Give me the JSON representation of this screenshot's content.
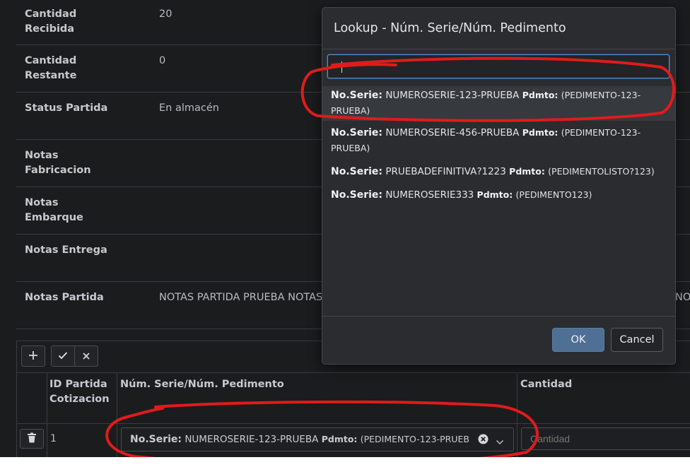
{
  "form": {
    "rows": [
      {
        "label": "Cantidad Recibida",
        "value": "20"
      },
      {
        "label": "Cantidad Restante",
        "value": "0"
      },
      {
        "label": "Status Partida",
        "value": "En almacén"
      },
      {
        "label": "Notas Fabricacion",
        "value": ""
      },
      {
        "label": "Notas Embarque",
        "value": ""
      },
      {
        "label": "Notas Entrega",
        "value": ""
      },
      {
        "label": "Notas Partida",
        "value": "NOTAS PARTIDA PRUEBA NOTAS",
        "value_overflow": "NOT"
      }
    ]
  },
  "grid": {
    "toolbar": {
      "add_icon": "plus-icon",
      "save_icon": "check-icon",
      "cancel_icon": "x-icon"
    },
    "headers": {
      "id": "ID Partida Cotizacion",
      "serie": "Núm. Serie/Núm. Pedimento",
      "cantidad": "Cantidad"
    },
    "row": {
      "id": "1",
      "delete_icon": "trash-icon",
      "serie_key": "No.Serie:",
      "serie_value": "NUMEROSERIE-123-PRUEBA",
      "pdmto_key": "Pdmto:",
      "pdmto_value": "(PEDIMENTO-123-PRUEB",
      "cantidad_placeholder": "Cantidad"
    }
  },
  "modal": {
    "title": "Lookup - Núm. Serie/Núm. Pedimento",
    "search_value": "",
    "options": [
      {
        "serie_key": "No.Serie:",
        "serie": "NUMEROSERIE-123-PRUEBA",
        "pdmto_key": "Pdmto:",
        "pdmto": "(PEDIMENTO-123-PRUEBA)",
        "selected": true
      },
      {
        "serie_key": "No.Serie:",
        "serie": "NUMEROSERIE-456-PRUEBA",
        "pdmto_key": "Pdmto:",
        "pdmto": "(PEDIMENTO-123-PRUEBA)",
        "selected": false
      },
      {
        "serie_key": "No.Serie:",
        "serie": "PRUEBADEFINITIVA?1223",
        "pdmto_key": "Pdmto:",
        "pdmto": "(PEDIMENTOLISTO?123)",
        "selected": false
      },
      {
        "serie_key": "No.Serie:",
        "serie": "NUMEROSERIE333",
        "pdmto_key": "Pdmto:",
        "pdmto": "(PEDIMENTO123)",
        "selected": false
      }
    ],
    "ok_label": "OK",
    "cancel_label": "Cancel"
  },
  "colors": {
    "annotation": "#e01b1b",
    "primary_button": "#4f6f94",
    "focus": "#4f8fd6"
  }
}
